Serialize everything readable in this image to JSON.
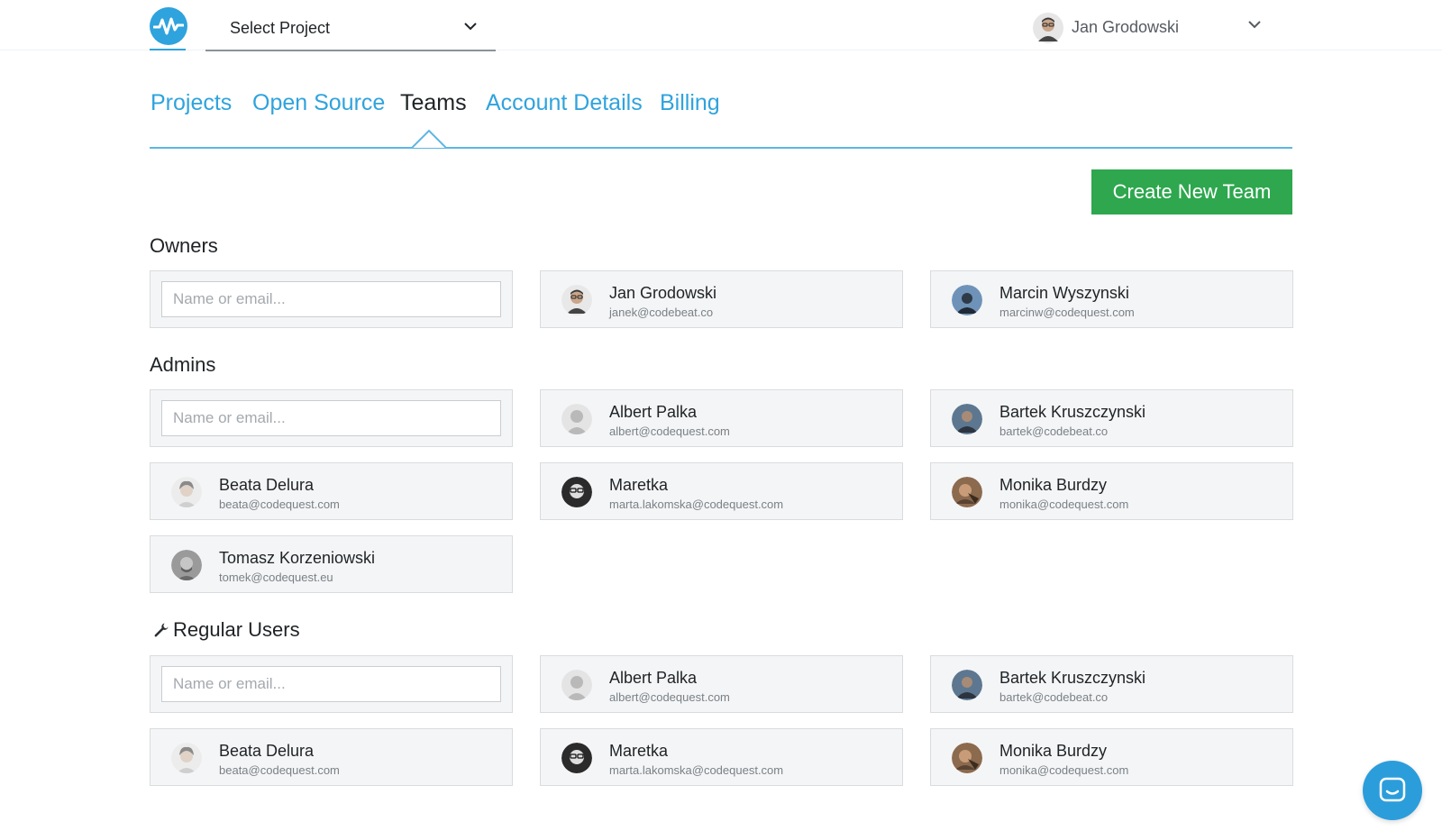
{
  "header": {
    "project_select_label": "Select Project",
    "user_name": "Jan Grodowski"
  },
  "tabs": [
    {
      "label": "Projects",
      "active": false
    },
    {
      "label": "Open Source",
      "active": false
    },
    {
      "label": "Teams",
      "active": true
    },
    {
      "label": "Account Details",
      "active": false
    },
    {
      "label": "Billing",
      "active": false
    }
  ],
  "create_button_label": "Create New Team",
  "sections": {
    "owners": {
      "title": "Owners",
      "input_placeholder": "Name or email...",
      "members": [
        {
          "name": "Jan Grodowski",
          "email": "janek@codebeat.co"
        },
        {
          "name": "Marcin Wyszynski",
          "email": "marcinw@codequest.com"
        }
      ]
    },
    "admins": {
      "title": "Admins",
      "input_placeholder": "Name or email...",
      "members": [
        {
          "name": "Albert Palka",
          "email": "albert@codequest.com"
        },
        {
          "name": "Bartek Kruszczynski",
          "email": "bartek@codebeat.co"
        },
        {
          "name": "Beata Delura",
          "email": "beata@codequest.com"
        },
        {
          "name": "Maretka",
          "email": "marta.lakomska@codequest.com"
        },
        {
          "name": "Monika Burdzy",
          "email": "monika@codequest.com"
        },
        {
          "name": "Tomasz Korzeniowski",
          "email": "tomek@codequest.eu"
        }
      ]
    },
    "regular": {
      "title": "Regular Users",
      "input_placeholder": "Name or email...",
      "members": [
        {
          "name": "Albert Palka",
          "email": "albert@codequest.com"
        },
        {
          "name": "Bartek Kruszczynski",
          "email": "bartek@codebeat.co"
        },
        {
          "name": "Beata Delura",
          "email": "beata@codequest.com"
        },
        {
          "name": "Maretka",
          "email": "marta.lakomska@codequest.com"
        },
        {
          "name": "Monika Burdzy",
          "email": "monika@codequest.com"
        }
      ]
    }
  },
  "colors": {
    "accent": "#2fa3dd",
    "create_button": "#2ea74e",
    "chat_button": "#2c9ddb"
  },
  "icons": {
    "logo": "pulse-logo-icon",
    "dropdown": "chevron-down-icon",
    "section_regular": "wrench-icon",
    "chat": "chat-bubble-icon"
  }
}
